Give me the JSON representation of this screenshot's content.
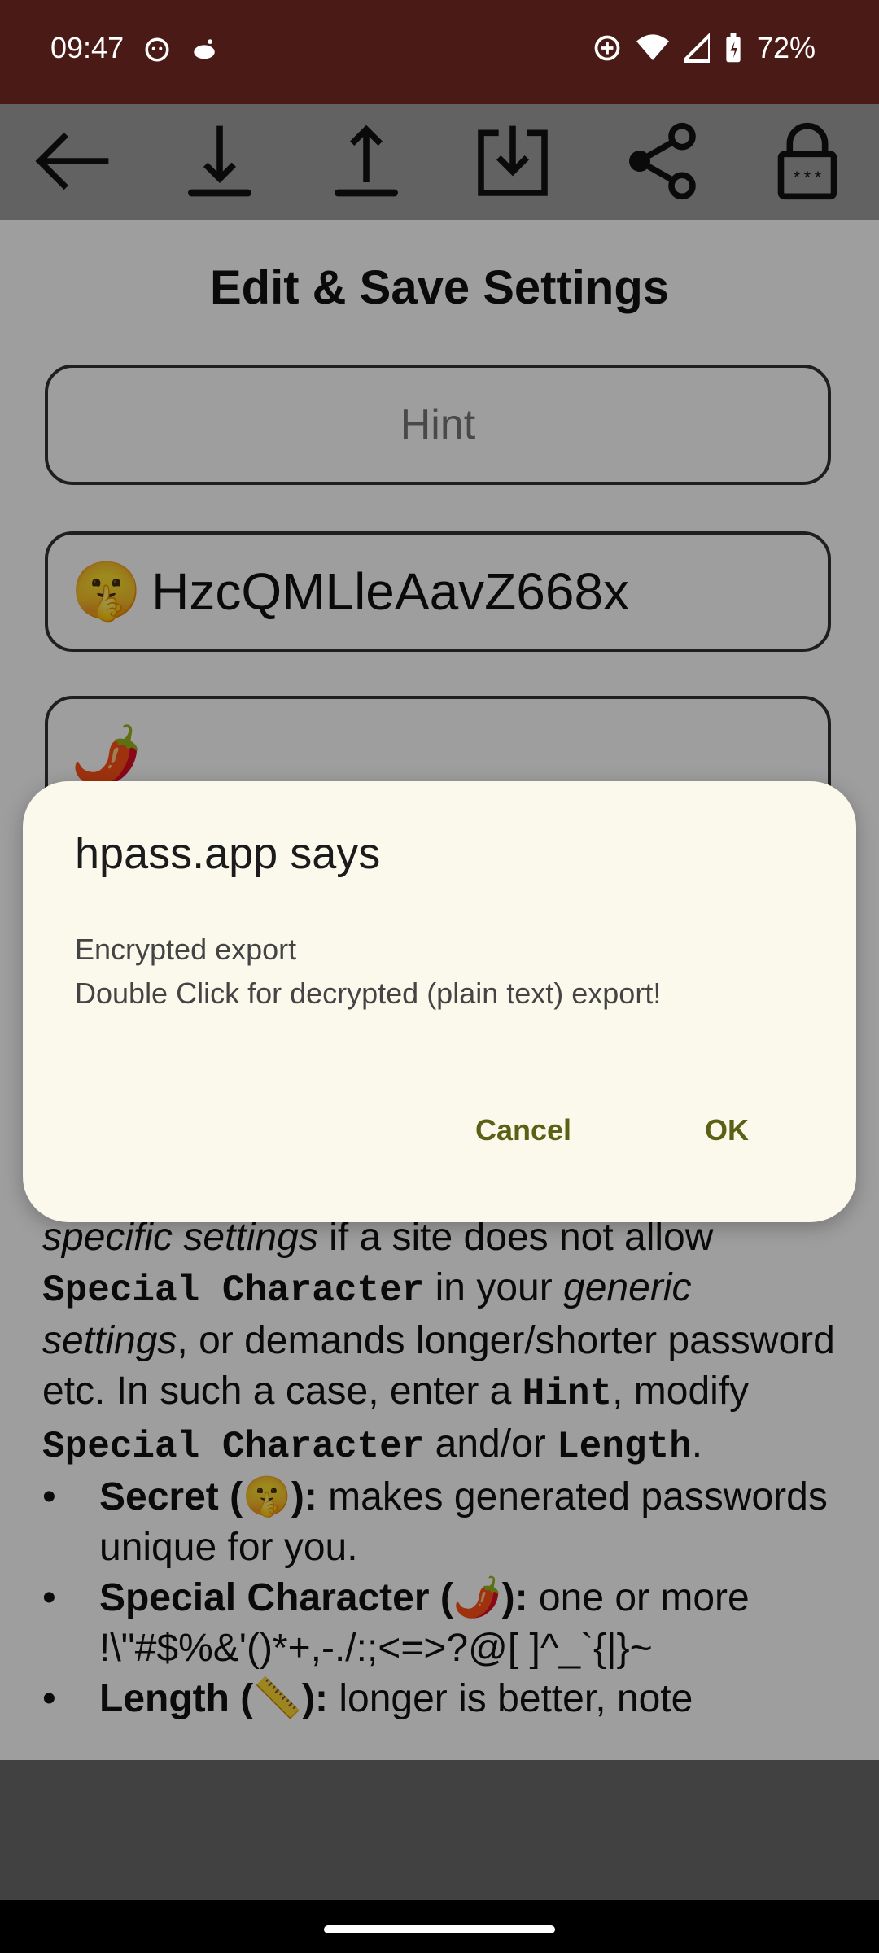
{
  "status_bar": {
    "time": "09:47",
    "battery": "72%",
    "left_icons": [
      "face-icon",
      "reddit-icon"
    ],
    "right_icons": [
      "data-saver-icon",
      "wifi-icon",
      "signal-icon",
      "battery-icon"
    ]
  },
  "toolbar": {
    "buttons": [
      "back-arrow-icon",
      "download-icon",
      "upload-icon",
      "import-icon",
      "share-icon",
      "lock-icon"
    ]
  },
  "page": {
    "title": "Edit & Save Settings",
    "hint_placeholder": "Hint",
    "secret_value": "HzcQMLleAavZ668x",
    "secret_emoji": "🤫",
    "special_emoji": "🌶️"
  },
  "help": {
    "p1_a": "specific settings",
    "p1_b": " if a site does not allow ",
    "p1_code1": "Special Character",
    "p1_c": " in your ",
    "p1_d": "generic settings",
    "p1_e": ", or demands longer/shorter password etc. In such a case, enter a ",
    "p1_code2": "Hint",
    "p1_f": ", modify ",
    "p1_code3": "Special Character",
    "p1_g": " and/or ",
    "p1_code4": "Length",
    "p1_h": ".",
    "b1_label": "Secret (🤫):",
    "b1_text": " makes generated passwords unique for you.",
    "b2_label": "Special Character (🌶️):",
    "b2_text": " one or more !\\\"#$%&'()*+,-./:;<=>?@[ ]^_`{|}~",
    "b3_label": "Length (📏):",
    "b3_text": " longer is better, note"
  },
  "dialog": {
    "title": "hpass.app says",
    "message": "Encrypted export\nDouble Click for decrypted (plain text) export!",
    "cancel_label": "Cancel",
    "ok_label": "OK"
  },
  "colors": {
    "status_bar": "#4a1a16",
    "toolbar": "#9e9e9e",
    "dialog_bg": "#fbf9ec",
    "dialog_button": "#5b6014"
  }
}
